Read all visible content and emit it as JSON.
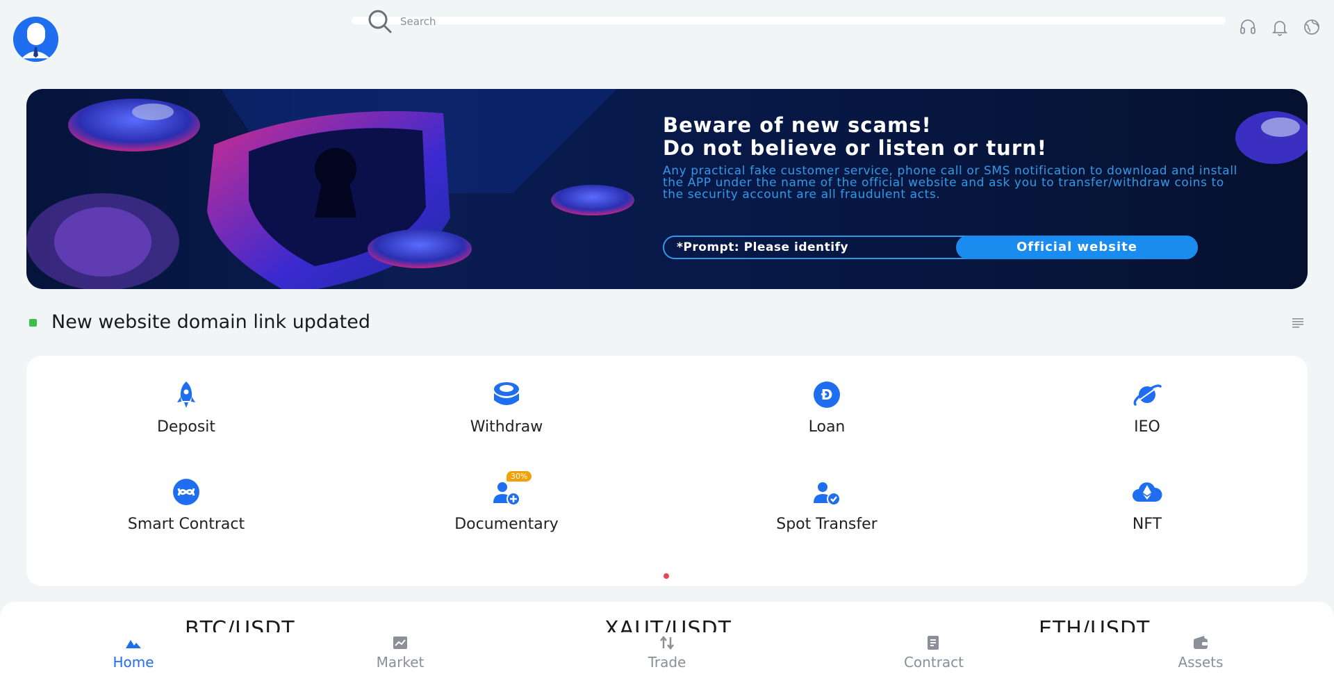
{
  "header": {
    "search_placeholder": "Search",
    "icons": [
      "headset-icon",
      "bell-icon",
      "globe-icon"
    ]
  },
  "banner": {
    "title_line1": "Beware of new scams!",
    "title_line2": "Do not believe or listen or turn!",
    "body": "Any practical fake customer service, phone call or SMS notification to download and install the APP under the name of the official website and ask you to transfer/withdraw coins to the security account are all fraudulent acts.",
    "prompt_label": "*Prompt: Please identify",
    "prompt_button": "Official website"
  },
  "notice": {
    "text": "New website domain link updated"
  },
  "grid": {
    "items": [
      {
        "label": "Deposit",
        "icon": "rocket-icon"
      },
      {
        "label": "Withdraw",
        "icon": "coin-stack-icon"
      },
      {
        "label": "Loan",
        "icon": "dogecoin-icon"
      },
      {
        "label": "IEO",
        "icon": "planet-icon"
      },
      {
        "label": "Smart Contract",
        "icon": "contract-swap-icon"
      },
      {
        "label": "Documentary",
        "icon": "user-add-icon",
        "badge": "30%"
      },
      {
        "label": "Spot Transfer",
        "icon": "user-check-icon"
      },
      {
        "label": "NFT",
        "icon": "ethereum-cloud-icon"
      }
    ]
  },
  "market": {
    "pairs": [
      "BTC/USDT",
      "XAUT/USDT",
      "ETH/USDT"
    ]
  },
  "nav": {
    "items": [
      {
        "label": "Home",
        "active": true
      },
      {
        "label": "Market",
        "active": false
      },
      {
        "label": "Trade",
        "active": false
      },
      {
        "label": "Contract",
        "active": false
      },
      {
        "label": "Assets",
        "active": false
      }
    ]
  },
  "colors": {
    "accent": "#1f6ef0",
    "background": "#f1f5f6",
    "badge": "#f2a10b",
    "pager_dot": "#e8445a"
  }
}
